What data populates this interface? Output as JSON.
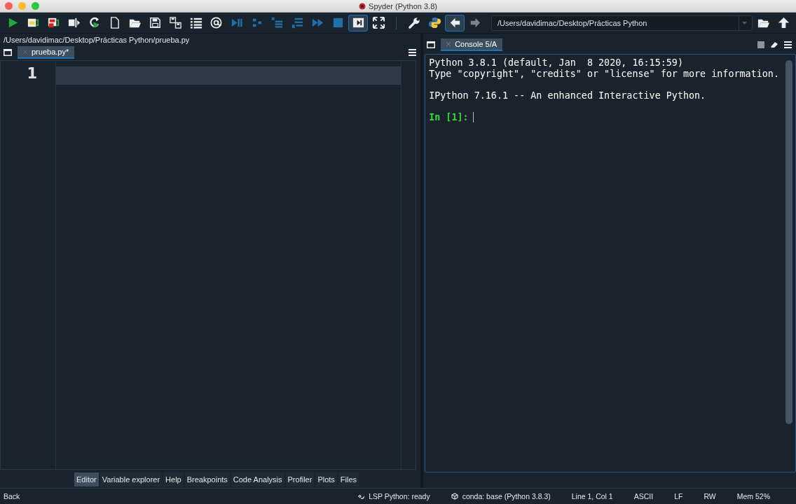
{
  "window": {
    "title": "Spyder (Python 3.8)"
  },
  "toolbar": {
    "buttons": [
      {
        "kind": "run",
        "selected": false
      },
      {
        "kind": "run-cell",
        "selected": false
      },
      {
        "kind": "run-cell-advance",
        "selected": false
      },
      {
        "kind": "run-selection",
        "selected": false
      },
      {
        "kind": "rerun",
        "selected": false
      },
      {
        "kind": "new-file",
        "selected": false
      },
      {
        "kind": "open-file",
        "selected": false
      },
      {
        "kind": "save",
        "selected": false
      },
      {
        "kind": "save-all",
        "selected": false
      },
      {
        "kind": "outline",
        "selected": false
      },
      {
        "kind": "at",
        "selected": false
      },
      {
        "kind": "debug",
        "selected": false
      },
      {
        "kind": "step",
        "selected": false
      },
      {
        "kind": "step-into",
        "selected": false
      },
      {
        "kind": "step-return",
        "selected": false
      },
      {
        "kind": "continue",
        "selected": false
      },
      {
        "kind": "stop",
        "selected": false
      },
      {
        "kind": "maximize",
        "selected": true
      },
      {
        "kind": "fullscreen",
        "selected": false
      },
      {
        "kind": "preferences",
        "selected": false
      },
      {
        "kind": "python",
        "selected": false
      },
      {
        "kind": "back",
        "selected": true
      },
      {
        "kind": "forward",
        "selected": false
      }
    ],
    "path": "/Users/davidimac/Desktop/Prácticas Python"
  },
  "editor": {
    "file_path": "/Users/davidimac/Desktop/Prácticas Python/prueba.py",
    "tabs": [
      {
        "label": "prueba.py*",
        "selected": true
      }
    ],
    "line_numbers": [
      "1"
    ]
  },
  "console": {
    "tabs": [
      {
        "label": "Console 5/A",
        "selected": true
      }
    ],
    "blocks": [
      [
        "Python 3.8.1 (default, Jan  8 2020, 16:15:59)",
        "Type \"copyright\", \"credits\" or \"license\" for more information."
      ],
      [
        "IPython 7.16.1 -- An enhanced Interactive Python."
      ]
    ],
    "prompt": "In [1]:"
  },
  "pane_tabs": [
    {
      "label": "Editor",
      "selected": true
    },
    {
      "label": "Variable explorer",
      "selected": false
    },
    {
      "label": "Help",
      "selected": false
    },
    {
      "label": "Breakpoints",
      "selected": false
    },
    {
      "label": "Code Analysis",
      "selected": false
    },
    {
      "label": "Profiler",
      "selected": false
    },
    {
      "label": "Plots",
      "selected": false
    },
    {
      "label": "Files",
      "selected": false
    }
  ],
  "status_bar": {
    "message": "Back",
    "items": [
      {
        "kind": "lsp",
        "text": "LSP Python: ready"
      },
      {
        "kind": "conda",
        "text": "conda: base (Python 3.8.3)"
      },
      {
        "kind": "plain",
        "text": "Line 1, Col 1"
      },
      {
        "kind": "plain",
        "text": "ASCII"
      },
      {
        "kind": "plain",
        "text": "LF"
      },
      {
        "kind": "plain",
        "text": "RW"
      },
      {
        "kind": "plain",
        "text": "Mem 52%"
      }
    ]
  }
}
